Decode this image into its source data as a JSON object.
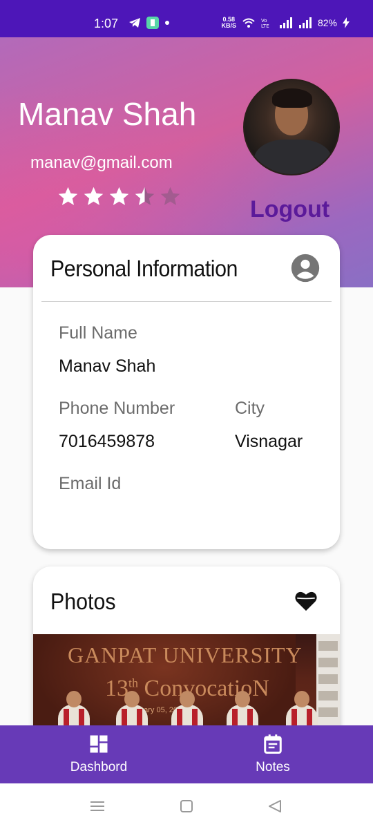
{
  "status_bar": {
    "time": "1:07",
    "speed_value": "0.58",
    "speed_unit": "KB/S",
    "battery": "82%",
    "icons": [
      "telegram-icon",
      "app-icon",
      "dot-icon",
      "wifi-icon",
      "volte-icon",
      "signal-icon",
      "signal-icon",
      "charging-icon"
    ]
  },
  "profile": {
    "name": "Manav Shah",
    "email": "manav@gmail.com",
    "rating": 3.5,
    "rating_max": 5,
    "logout_label": "Logout"
  },
  "personal_info": {
    "title": "Personal Information",
    "icon": "account-circle-icon",
    "full_name_label": "Full Name",
    "full_name_value": "Manav Shah",
    "phone_label": "Phone Number",
    "phone_value": "7016459878",
    "city_label": "City",
    "city_value": "Visnagar",
    "email_label": "Email Id"
  },
  "photos": {
    "title": "Photos",
    "icon": "heart-icon",
    "photo_title": "GANPAT UNIVERSITY",
    "photo_sub_num": "13",
    "photo_sub_sup": "th",
    "photo_sub_text": "ConvocatioN",
    "photo_date": "uary 05, 202"
  },
  "bottom_nav": {
    "dashboard_label": "Dashbord",
    "notes_label": "Notes"
  },
  "colors": {
    "status_bar": "#4d16b8",
    "nav_bar": "#673ab7",
    "logout": "#5b1a9a"
  }
}
